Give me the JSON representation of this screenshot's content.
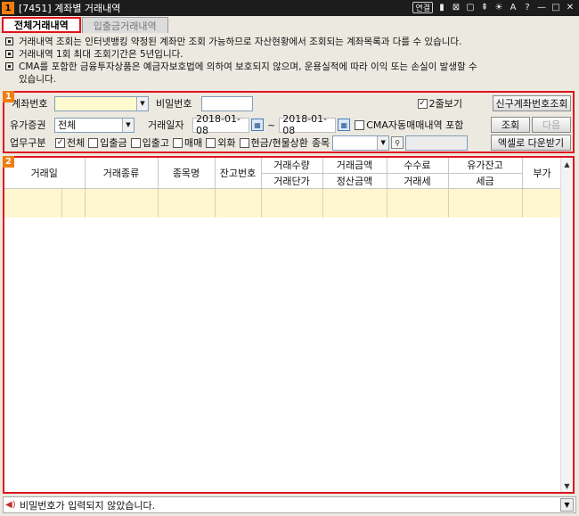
{
  "window": {
    "number": "1",
    "title": "[7451] 계좌별 거래내역",
    "toolbar": [
      "연결",
      "▮",
      "⊠",
      "▢",
      "⇞",
      "☀",
      "A",
      "?",
      "—",
      "□",
      "✕"
    ]
  },
  "tabs": [
    {
      "label": "전체거래내역",
      "active": true
    },
    {
      "label": "입출금거래내역",
      "active": false
    }
  ],
  "notices": [
    "거래내역 조회는 인터넷뱅킹 약정된 계좌만 조회 가능하므로 자산현황에서 조회되는 계좌목록과 다를 수 있습니다.",
    "거래내역 1회 최대 조회기간은 5년입니다.",
    "CMA를 포함한 금융투자상품은 예금자보호법에 의하여 보호되지 않으며, 운용실적에 따라 이익 또는 손실이 발생할 수",
    "있습니다."
  ],
  "search": {
    "badge": "1",
    "account_label": "계좌번호",
    "account_value": "",
    "password_label": "비밀번호",
    "password_value": "",
    "two_line_label": "2줄보기",
    "two_line_checked": "✓",
    "new_account_button": "신구계좌번호조회",
    "securities_label": "유가증권",
    "securities_value": "전체",
    "date_label": "거래일자",
    "date_from": "2018-01-08",
    "date_tilde": "~",
    "date_to": "2018-01-08",
    "cma_label": "CMA자동매매내역 포함",
    "query_button": "조회",
    "next_button": "다음",
    "type_label": "업무구분",
    "checks": [
      {
        "label": "전체",
        "checked": "✓"
      },
      {
        "label": "입출금",
        "checked": ""
      },
      {
        "label": "입출고",
        "checked": ""
      },
      {
        "label": "매매",
        "checked": ""
      },
      {
        "label": "외화",
        "checked": ""
      },
      {
        "label": "현금/현물상환",
        "checked": ""
      }
    ],
    "item_label": "종목",
    "item_value": "",
    "excel_button": "엑셀로 다운받기"
  },
  "grid": {
    "badge": "2",
    "headers": {
      "trade_date": "거래일",
      "trade_type": "거래종류",
      "item_name": "종목명",
      "balance_no": "잔고번호",
      "qty": "거래수량",
      "unit_price": "거래단가",
      "amount": "거래금액",
      "settle_amount": "정산금액",
      "fee": "수수료",
      "tax": "거래세",
      "sec_balance": "유가잔고",
      "levy": "세금",
      "vat": "부가"
    }
  },
  "status": {
    "message": "비밀번호가 입력되지 않았습니다."
  }
}
